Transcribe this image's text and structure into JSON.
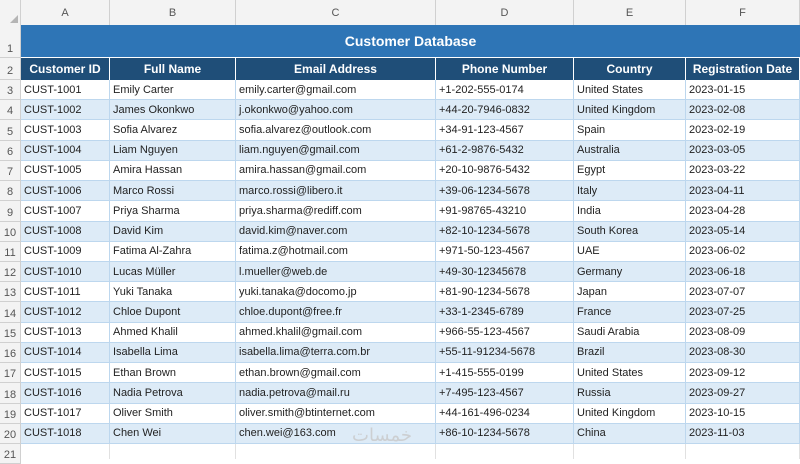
{
  "column_letters": [
    "A",
    "B",
    "C",
    "D",
    "E",
    "F"
  ],
  "row_numbers": [
    "1",
    "2",
    "3",
    "4",
    "5",
    "6",
    "7",
    "8",
    "9",
    "10",
    "11",
    "12",
    "13",
    "14",
    "15",
    "16",
    "17",
    "18",
    "19",
    "20",
    "21"
  ],
  "title": "Customer Database",
  "headers": [
    "Customer ID",
    "Full Name",
    "Email Address",
    "Phone Number",
    "Country",
    "Registration Date"
  ],
  "rows": [
    [
      "CUST-1001",
      "Emily Carter",
      "emily.carter@gmail.com",
      "+1-202-555-0174",
      "United States",
      "2023-01-15"
    ],
    [
      "CUST-1002",
      "James Okonkwo",
      "j.okonkwo@yahoo.com",
      "+44-20-7946-0832",
      "United Kingdom",
      "2023-02-08"
    ],
    [
      "CUST-1003",
      "Sofia Alvarez",
      "sofia.alvarez@outlook.com",
      "+34-91-123-4567",
      "Spain",
      "2023-02-19"
    ],
    [
      "CUST-1004",
      "Liam Nguyen",
      "liam.nguyen@gmail.com",
      "+61-2-9876-5432",
      "Australia",
      "2023-03-05"
    ],
    [
      "CUST-1005",
      "Amira Hassan",
      "amira.hassan@gmail.com",
      "+20-10-9876-5432",
      "Egypt",
      "2023-03-22"
    ],
    [
      "CUST-1006",
      "Marco Rossi",
      "marco.rossi@libero.it",
      "+39-06-1234-5678",
      "Italy",
      "2023-04-11"
    ],
    [
      "CUST-1007",
      "Priya Sharma",
      "priya.sharma@rediff.com",
      "+91-98765-43210",
      "India",
      "2023-04-28"
    ],
    [
      "CUST-1008",
      "David Kim",
      "david.kim@naver.com",
      "+82-10-1234-5678",
      "South Korea",
      "2023-05-14"
    ],
    [
      "CUST-1009",
      "Fatima Al-Zahra",
      "fatima.z@hotmail.com",
      "+971-50-123-4567",
      "UAE",
      "2023-06-02"
    ],
    [
      "CUST-1010",
      "Lucas Müller",
      "l.mueller@web.de",
      "+49-30-12345678",
      "Germany",
      "2023-06-18"
    ],
    [
      "CUST-1011",
      "Yuki Tanaka",
      "yuki.tanaka@docomo.jp",
      "+81-90-1234-5678",
      "Japan",
      "2023-07-07"
    ],
    [
      "CUST-1012",
      "Chloe Dupont",
      "chloe.dupont@free.fr",
      "+33-1-2345-6789",
      "France",
      "2023-07-25"
    ],
    [
      "CUST-1013",
      "Ahmed Khalil",
      "ahmed.khalil@gmail.com",
      "+966-55-123-4567",
      "Saudi Arabia",
      "2023-08-09"
    ],
    [
      "CUST-1014",
      "Isabella Lima",
      "isabella.lima@terra.com.br",
      "+55-11-91234-5678",
      "Brazil",
      "2023-08-30"
    ],
    [
      "CUST-1015",
      "Ethan Brown",
      "ethan.brown@gmail.com",
      "+1-415-555-0199",
      "United States",
      "2023-09-12"
    ],
    [
      "CUST-1016",
      "Nadia Petrova",
      "nadia.petrova@mail.ru",
      "+7-495-123-4567",
      "Russia",
      "2023-09-27"
    ],
    [
      "CUST-1017",
      "Oliver Smith",
      "oliver.smith@btinternet.com",
      "+44-161-496-0234",
      "United Kingdom",
      "2023-10-15"
    ],
    [
      "CUST-1018",
      "Chen Wei",
      "chen.wei@163.com",
      "+86-10-1234-5678",
      "China",
      "2023-11-03"
    ]
  ],
  "watermark": "خمسات",
  "colors": {
    "title_bg": "#2e75b6",
    "header_bg": "#1f4e78",
    "alt_row_bg": "#ddebf7",
    "grid_line": "#bdd7ee"
  }
}
